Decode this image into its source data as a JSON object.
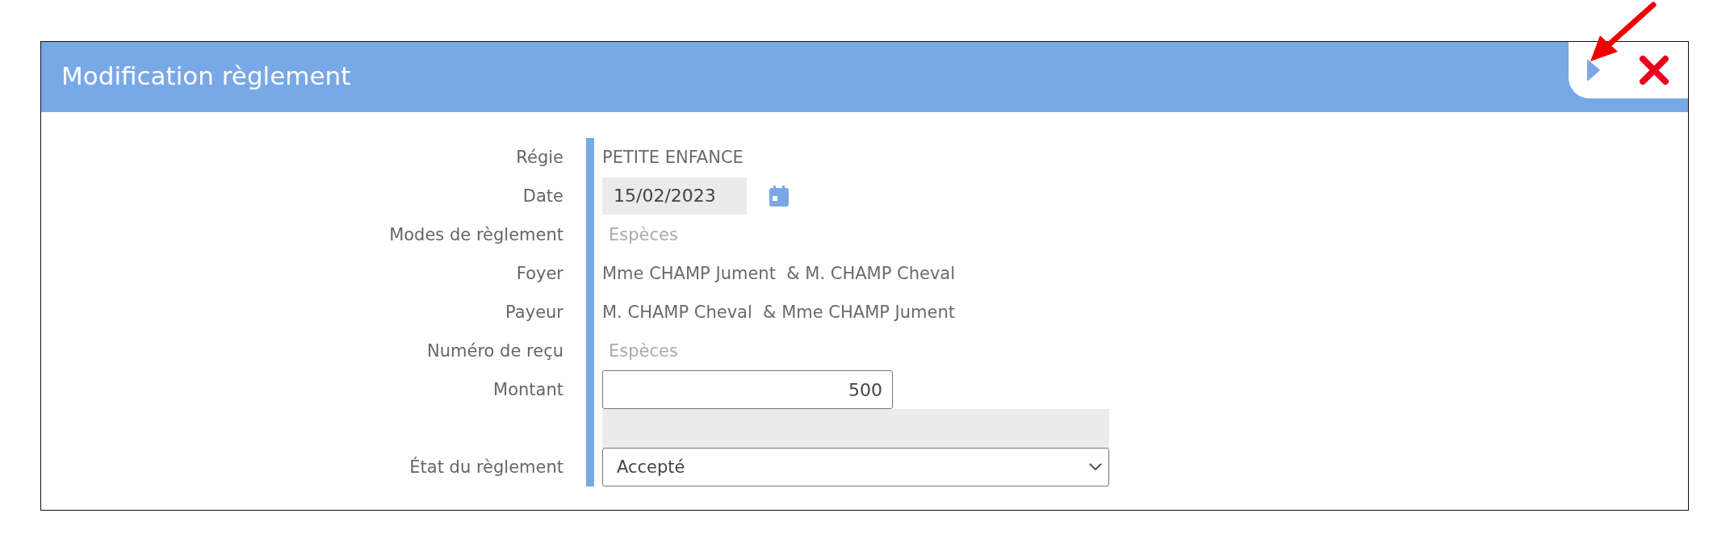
{
  "dialog": {
    "title": "Modification règlement",
    "fields": [
      {
        "kind": "text",
        "label": "Régie",
        "value": "PETITE ENFANCE"
      },
      {
        "kind": "date",
        "label": "Date",
        "value": "15/02/2023"
      },
      {
        "kind": "muted",
        "label": "Modes de règlement",
        "value": "Espèces"
      },
      {
        "kind": "text",
        "label": "Foyer",
        "value": "Mme CHAMP Jument  & M. CHAMP Cheval"
      },
      {
        "kind": "text",
        "label": "Payeur",
        "value": "M. CHAMP Cheval  & Mme CHAMP Jument"
      },
      {
        "kind": "muted",
        "label": "Numéro de reçu",
        "value": "Espèces"
      },
      {
        "kind": "input",
        "label": "Montant",
        "value": "500"
      },
      {
        "kind": "blank"
      },
      {
        "kind": "select",
        "label": "État du règlement",
        "value": "Accepté"
      }
    ]
  }
}
